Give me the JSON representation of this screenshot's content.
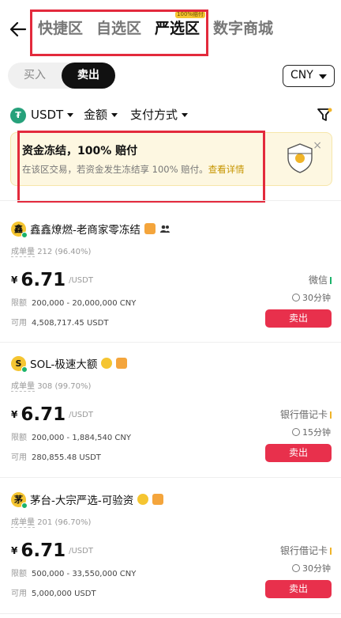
{
  "header": {
    "tabs": [
      {
        "label": "快捷区",
        "active": false
      },
      {
        "label": "自选区",
        "active": false
      },
      {
        "label": "严选区",
        "active": true,
        "badge": "100%赔付"
      },
      {
        "label": "数字商城",
        "active": false
      }
    ]
  },
  "trade_toggle": {
    "buy_label": "买入",
    "sell_label": "卖出",
    "selected": "sell"
  },
  "currency": {
    "value": "CNY"
  },
  "filters": {
    "coin": "USDT",
    "amount": "金额",
    "payment": "支付方式"
  },
  "banner": {
    "title": "资金冻结，100% 赔付",
    "description": "在该区交易，若资金发生冻结享 100% 赔付。",
    "link": "查看详情",
    "close": "×"
  },
  "listings": [
    {
      "avatar": "鑫",
      "name": "鑫鑫燎燃-老商家零冻结",
      "stats_label": "成单量",
      "stats_value": "212 (96.40%)",
      "currency_symbol": "¥",
      "price": "6.71",
      "unit": "/USDT",
      "limit_label": "限额",
      "limit": "200,000 - 20,000,000 CNY",
      "available_label": "可用",
      "available": "4,508,717.45 USDT",
      "payment": "微信",
      "payment_color": "#1bb36b",
      "time": "30分钟",
      "action": "卖出"
    },
    {
      "avatar": "S",
      "name": "SOL-极速大额",
      "stats_label": "成单量",
      "stats_value": "308 (99.70%)",
      "currency_symbol": "¥",
      "price": "6.71",
      "unit": "/USDT",
      "limit_label": "限额",
      "limit": "200,000 - 1,884,540 CNY",
      "available_label": "可用",
      "available": "280,855.48 USDT",
      "payment": "银行借记卡",
      "payment_color": "#f0b429",
      "time": "15分钟",
      "action": "卖出"
    },
    {
      "avatar": "茅",
      "name": "茅台-大宗严选-可验资",
      "stats_label": "成单量",
      "stats_value": "201 (96.70%)",
      "currency_symbol": "¥",
      "price": "6.71",
      "unit": "/USDT",
      "limit_label": "限额",
      "limit": "500,000 - 33,550,000 CNY",
      "available_label": "可用",
      "available": "5,000,000 USDT",
      "payment": "银行借记卡",
      "payment_color": "#f0b429",
      "time": "30分钟",
      "action": "卖出"
    }
  ]
}
